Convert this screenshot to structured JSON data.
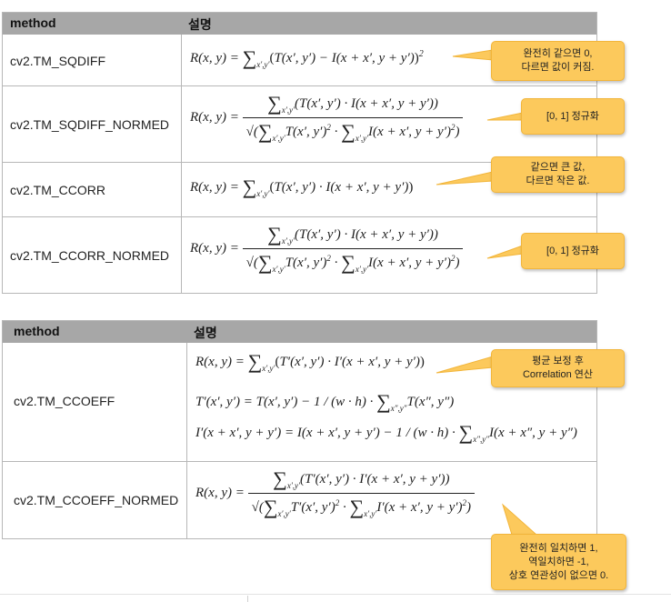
{
  "table1": {
    "header": {
      "method": "method",
      "desc": "설명"
    },
    "rows": [
      {
        "method": "cv2.TM_SQDIFF",
        "callout": "완전히 같으면 0,\n다르면 값이 커짐."
      },
      {
        "method": "cv2.TM_SQDIFF_NORMED",
        "callout": "[0, 1] 정규화"
      },
      {
        "method": "cv2.TM_CCORR",
        "callout": "같으면 큰 값,\n다르면 작은 값."
      },
      {
        "method": "cv2.TM_CCORR_NORMED",
        "callout": "[0, 1] 정규화"
      }
    ]
  },
  "table2": {
    "header": {
      "method": "method",
      "desc": "설명"
    },
    "rows": [
      {
        "method": "cv2.TM_CCOEFF",
        "callout": "평균 보정 후\nCorrelation 연산"
      },
      {
        "method": "cv2.TM_CCOEFF_NORMED",
        "callout": "완전히 일치하면 1,\n역일치하면 -1,\n상호 연관성이 없으면 0."
      }
    ]
  },
  "colors": {
    "header_bg": "#a7a7a7",
    "callout_bg": "#fcc95c",
    "border": "#b7b7b7"
  }
}
